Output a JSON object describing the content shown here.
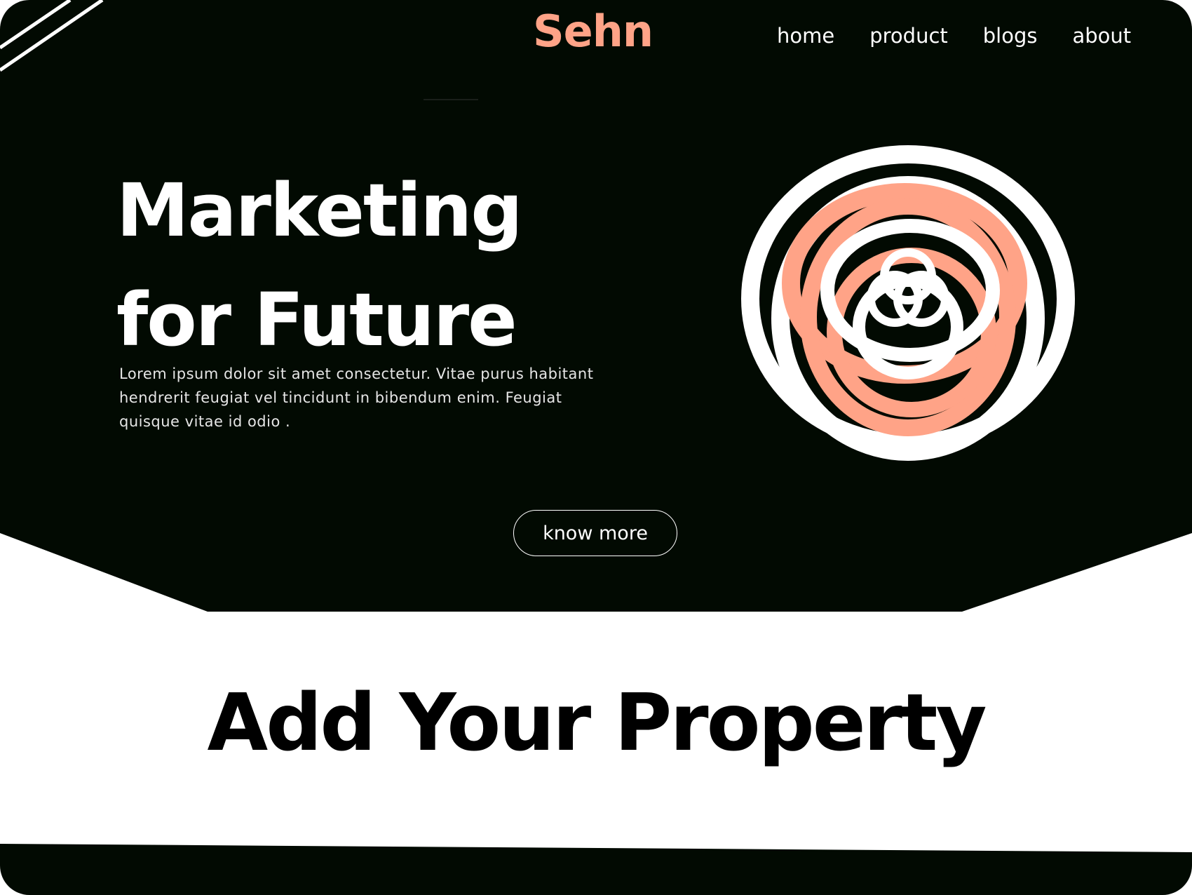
{
  "brand": {
    "logo": "Sehn",
    "accent_color": "#FFA387",
    "dark_color": "#020A02"
  },
  "nav": {
    "items": [
      {
        "label": "home"
      },
      {
        "label": "product"
      },
      {
        "label": "blogs"
      },
      {
        "label": "about"
      }
    ]
  },
  "hero": {
    "title_line1": "Marketing",
    "title_line2": "for Future",
    "description": "Lorem ipsum dolor sit amet consectetur. Vitae purus habitant hendrerit feugiat vel tincidunt in bibendum enim. Feugiat quisque vitae id odio .",
    "cta_label": "know more",
    "emblem_icon": "rose-knot-emblem"
  },
  "section": {
    "title": "Add Your Property"
  }
}
